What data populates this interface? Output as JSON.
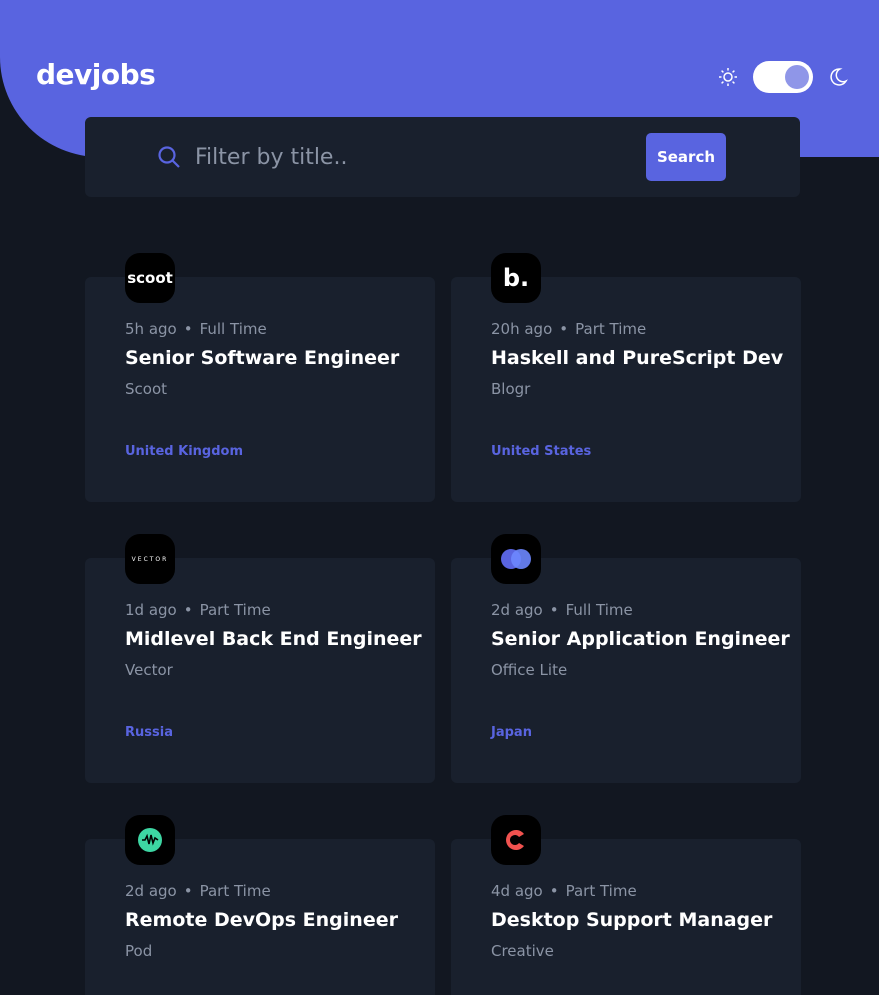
{
  "header": {
    "logo": "devjobs",
    "theme": {
      "sun_icon": "sun-icon",
      "moon_icon": "moon-icon",
      "dark_mode": true
    }
  },
  "search": {
    "placeholder": "Filter by title..",
    "button_label": "Search",
    "icon": "search-icon"
  },
  "jobs": [
    {
      "logo_text": "scoot",
      "logo_bg": "#000000",
      "posted": "5h ago",
      "contract": "Full Time",
      "title": "Senior Software Engineer",
      "company": "Scoot",
      "location": "United Kingdom"
    },
    {
      "logo_text": "b.",
      "logo_bg": "#000000",
      "posted": "20h ago",
      "contract": "Part Time",
      "title": "Haskell and PureScript Dev",
      "company": "Blogr",
      "location": "United States"
    },
    {
      "logo_text": "VECTOR",
      "logo_bg": "#000000",
      "posted": "1d ago",
      "contract": "Part Time",
      "title": "Midlevel Back End Engineer",
      "company": "Vector",
      "location": "Russia"
    },
    {
      "logo_text": "",
      "logo_bg": "#000000",
      "posted": "2d ago",
      "contract": "Full Time",
      "title": "Senior Application Engineer",
      "company": "Office Lite",
      "location": "Japan"
    },
    {
      "logo_text": "",
      "logo_bg": "#000000",
      "posted": "2d ago",
      "contract": "Part Time",
      "title": "Remote DevOps Engineer",
      "company": "Pod",
      "location": ""
    },
    {
      "logo_text": "",
      "logo_bg": "#000000",
      "posted": "4d ago",
      "contract": "Part Time",
      "title": "Desktop Support Manager",
      "company": "Creative",
      "location": ""
    }
  ],
  "colors": {
    "accent": "#5964e0",
    "background": "#121721",
    "card": "#19202d",
    "muted": "#8b94a5"
  }
}
